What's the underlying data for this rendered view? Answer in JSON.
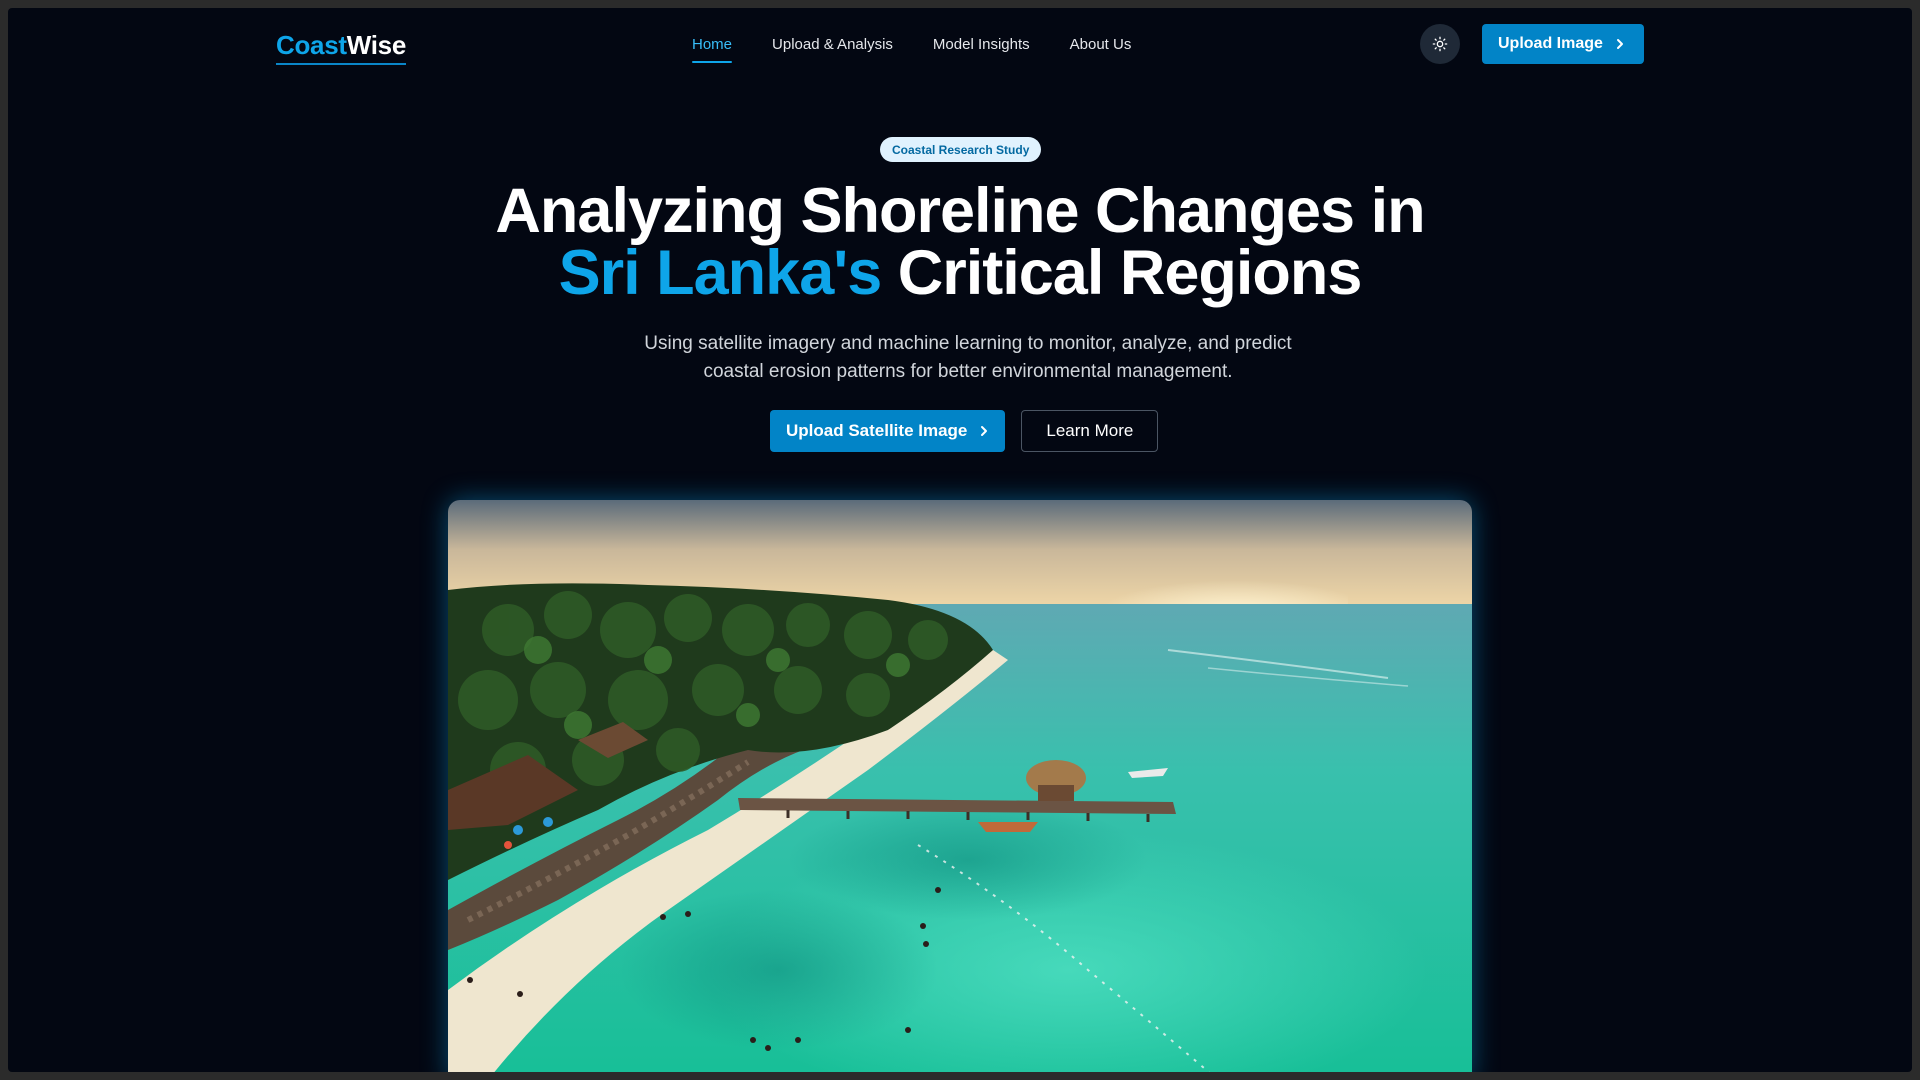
{
  "app": {
    "logo_part1": "Coast",
    "logo_part2": "Wise"
  },
  "nav": {
    "links": [
      {
        "label": "Home",
        "active": true
      },
      {
        "label": "Upload & Analysis",
        "active": false
      },
      {
        "label": "Model Insights",
        "active": false
      },
      {
        "label": "About Us",
        "active": false
      }
    ],
    "theme_toggle_icon": "sun-icon",
    "upload_button_label": "Upload Image"
  },
  "hero": {
    "badge": "Coastal Research Study",
    "headline_line1": "Analyzing Shoreline Changes in",
    "headline_highlight": "Sri Lanka's",
    "headline_rest": " Critical Regions",
    "subtitle_line1": "Using satellite imagery and machine learning to monitor, analyze, and predict",
    "subtitle_line2": "coastal erosion patterns for better environmental management.",
    "primary_cta": "Upload Satellite Image",
    "secondary_cta": "Learn More"
  },
  "colors": {
    "background": "#030712",
    "accent": "#0ea5e9",
    "primary_button": "#0284c7",
    "badge_bg": "#e0f2fe",
    "badge_text": "#0369a1"
  }
}
